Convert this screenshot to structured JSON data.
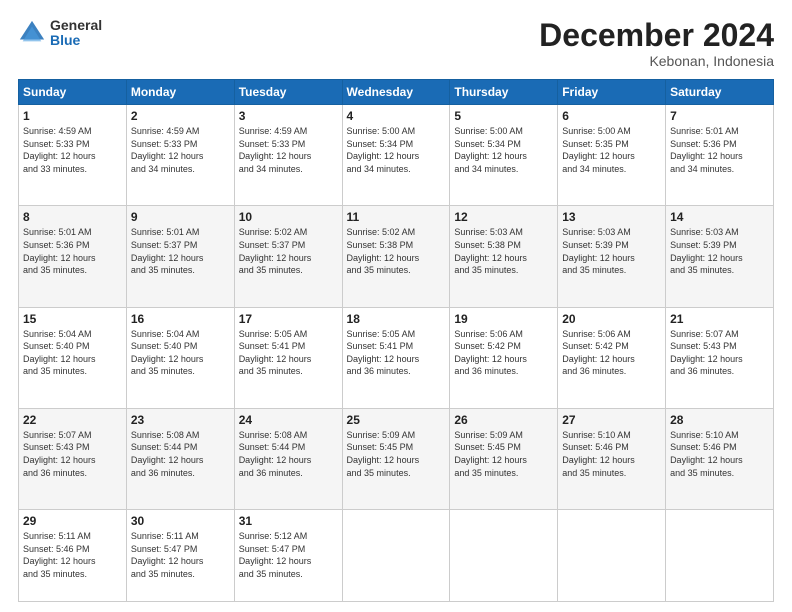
{
  "logo": {
    "general": "General",
    "blue": "Blue"
  },
  "title": "December 2024",
  "location": "Kebonan, Indonesia",
  "days_header": [
    "Sunday",
    "Monday",
    "Tuesday",
    "Wednesday",
    "Thursday",
    "Friday",
    "Saturday"
  ],
  "weeks": [
    [
      {
        "num": "1",
        "info": "Sunrise: 4:59 AM\nSunset: 5:33 PM\nDaylight: 12 hours\nand 33 minutes."
      },
      {
        "num": "2",
        "info": "Sunrise: 4:59 AM\nSunset: 5:33 PM\nDaylight: 12 hours\nand 34 minutes."
      },
      {
        "num": "3",
        "info": "Sunrise: 4:59 AM\nSunset: 5:33 PM\nDaylight: 12 hours\nand 34 minutes."
      },
      {
        "num": "4",
        "info": "Sunrise: 5:00 AM\nSunset: 5:34 PM\nDaylight: 12 hours\nand 34 minutes."
      },
      {
        "num": "5",
        "info": "Sunrise: 5:00 AM\nSunset: 5:34 PM\nDaylight: 12 hours\nand 34 minutes."
      },
      {
        "num": "6",
        "info": "Sunrise: 5:00 AM\nSunset: 5:35 PM\nDaylight: 12 hours\nand 34 minutes."
      },
      {
        "num": "7",
        "info": "Sunrise: 5:01 AM\nSunset: 5:36 PM\nDaylight: 12 hours\nand 34 minutes."
      }
    ],
    [
      {
        "num": "8",
        "info": "Sunrise: 5:01 AM\nSunset: 5:36 PM\nDaylight: 12 hours\nand 35 minutes."
      },
      {
        "num": "9",
        "info": "Sunrise: 5:01 AM\nSunset: 5:37 PM\nDaylight: 12 hours\nand 35 minutes."
      },
      {
        "num": "10",
        "info": "Sunrise: 5:02 AM\nSunset: 5:37 PM\nDaylight: 12 hours\nand 35 minutes."
      },
      {
        "num": "11",
        "info": "Sunrise: 5:02 AM\nSunset: 5:38 PM\nDaylight: 12 hours\nand 35 minutes."
      },
      {
        "num": "12",
        "info": "Sunrise: 5:03 AM\nSunset: 5:38 PM\nDaylight: 12 hours\nand 35 minutes."
      },
      {
        "num": "13",
        "info": "Sunrise: 5:03 AM\nSunset: 5:39 PM\nDaylight: 12 hours\nand 35 minutes."
      },
      {
        "num": "14",
        "info": "Sunrise: 5:03 AM\nSunset: 5:39 PM\nDaylight: 12 hours\nand 35 minutes."
      }
    ],
    [
      {
        "num": "15",
        "info": "Sunrise: 5:04 AM\nSunset: 5:40 PM\nDaylight: 12 hours\nand 35 minutes."
      },
      {
        "num": "16",
        "info": "Sunrise: 5:04 AM\nSunset: 5:40 PM\nDaylight: 12 hours\nand 35 minutes."
      },
      {
        "num": "17",
        "info": "Sunrise: 5:05 AM\nSunset: 5:41 PM\nDaylight: 12 hours\nand 35 minutes."
      },
      {
        "num": "18",
        "info": "Sunrise: 5:05 AM\nSunset: 5:41 PM\nDaylight: 12 hours\nand 36 minutes."
      },
      {
        "num": "19",
        "info": "Sunrise: 5:06 AM\nSunset: 5:42 PM\nDaylight: 12 hours\nand 36 minutes."
      },
      {
        "num": "20",
        "info": "Sunrise: 5:06 AM\nSunset: 5:42 PM\nDaylight: 12 hours\nand 36 minutes."
      },
      {
        "num": "21",
        "info": "Sunrise: 5:07 AM\nSunset: 5:43 PM\nDaylight: 12 hours\nand 36 minutes."
      }
    ],
    [
      {
        "num": "22",
        "info": "Sunrise: 5:07 AM\nSunset: 5:43 PM\nDaylight: 12 hours\nand 36 minutes."
      },
      {
        "num": "23",
        "info": "Sunrise: 5:08 AM\nSunset: 5:44 PM\nDaylight: 12 hours\nand 36 minutes."
      },
      {
        "num": "24",
        "info": "Sunrise: 5:08 AM\nSunset: 5:44 PM\nDaylight: 12 hours\nand 36 minutes."
      },
      {
        "num": "25",
        "info": "Sunrise: 5:09 AM\nSunset: 5:45 PM\nDaylight: 12 hours\nand 35 minutes."
      },
      {
        "num": "26",
        "info": "Sunrise: 5:09 AM\nSunset: 5:45 PM\nDaylight: 12 hours\nand 35 minutes."
      },
      {
        "num": "27",
        "info": "Sunrise: 5:10 AM\nSunset: 5:46 PM\nDaylight: 12 hours\nand 35 minutes."
      },
      {
        "num": "28",
        "info": "Sunrise: 5:10 AM\nSunset: 5:46 PM\nDaylight: 12 hours\nand 35 minutes."
      }
    ],
    [
      {
        "num": "29",
        "info": "Sunrise: 5:11 AM\nSunset: 5:46 PM\nDaylight: 12 hours\nand 35 minutes."
      },
      {
        "num": "30",
        "info": "Sunrise: 5:11 AM\nSunset: 5:47 PM\nDaylight: 12 hours\nand 35 minutes."
      },
      {
        "num": "31",
        "info": "Sunrise: 5:12 AM\nSunset: 5:47 PM\nDaylight: 12 hours\nand 35 minutes."
      },
      {
        "num": "",
        "info": ""
      },
      {
        "num": "",
        "info": ""
      },
      {
        "num": "",
        "info": ""
      },
      {
        "num": "",
        "info": ""
      }
    ]
  ]
}
